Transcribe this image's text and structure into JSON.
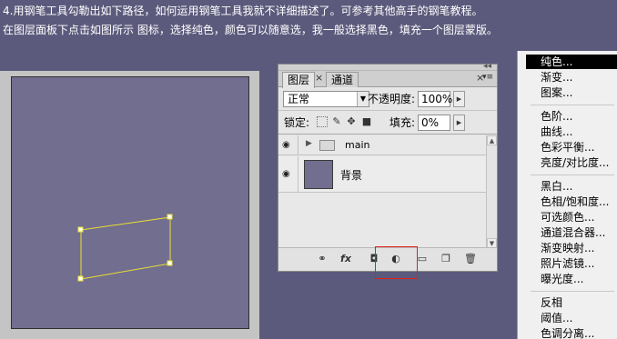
{
  "instructions": {
    "line1": "4.用钢笔工具勾勒出如下路径，如何运用钢笔工具我就不详细描述了。可参考其他高手的钢笔教程。",
    "line2": "在图层面板下点击如图所示 图标，选择纯色，颜色可以随意选，我一般选择黑色，填充一个图层蒙版。"
  },
  "layers_panel": {
    "tabs": [
      "图层",
      "通道"
    ],
    "blend_mode": "正常",
    "opacity_label": "不透明度:",
    "opacity_value": "100%",
    "lock_label": "锁定:",
    "fill_label": "填充:",
    "fill_value": "0%",
    "layers": [
      {
        "name": "main",
        "type": "group"
      },
      {
        "name": "背景",
        "type": "layer"
      }
    ],
    "bottom_icons": [
      "link-icon",
      "fx-icon",
      "mask-icon",
      "adjustment-layer-icon",
      "folder-icon",
      "new-layer-icon",
      "trash-icon"
    ],
    "fx_label": "fx"
  },
  "adjustment_menu": {
    "items": [
      "纯色...",
      "渐变...",
      "图案...",
      "色阶...",
      "曲线...",
      "色彩平衡...",
      "亮度/对比度...",
      "黑白...",
      "色相/饱和度...",
      "可选颜色...",
      "通道混合器...",
      "渐变映射...",
      "照片滤镜...",
      "曝光度...",
      "反相",
      "阈值...",
      "色调分离..."
    ],
    "selected": "纯色..."
  },
  "colors": {
    "background": "#5c5a7c",
    "canvas_fill": "#726e90",
    "path_stroke": "#e8e030",
    "highlight": "#e0201b",
    "menu_selected": "#000000"
  }
}
